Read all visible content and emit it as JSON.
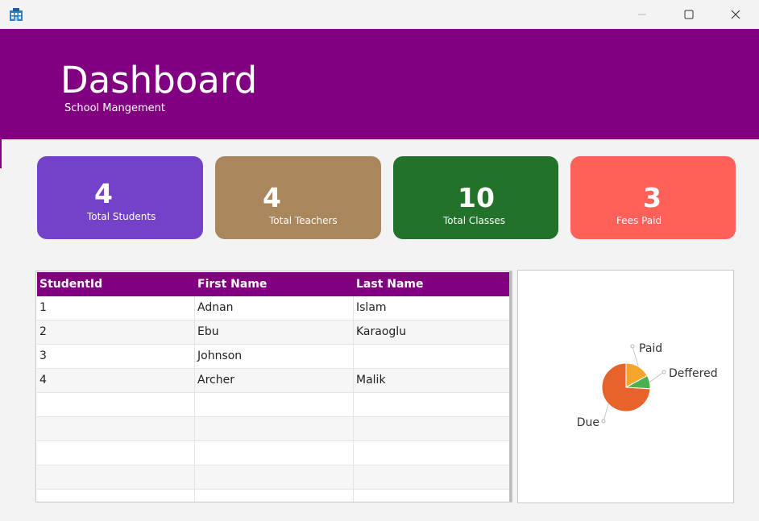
{
  "window": {
    "icon": "school-building-icon",
    "controls": [
      "minimize-icon",
      "maximize-icon",
      "close-icon"
    ]
  },
  "header": {
    "title": "Dashboard",
    "subtitle": "School Mangement",
    "color": "#800080"
  },
  "cards": [
    {
      "value": "4",
      "label": "Total Students",
      "color": "#7442c8"
    },
    {
      "value": "4",
      "label": "Total Teachers",
      "color": "#a9865b"
    },
    {
      "value": "10",
      "label": "Total Classes",
      "color": "#23722a"
    },
    {
      "value": "3",
      "label": "Fees Paid",
      "color": "#ff6058"
    }
  ],
  "table": {
    "columns": [
      "StudentId",
      "First Name",
      "Last Name"
    ],
    "rows": [
      [
        "1",
        "Adnan",
        "Islam"
      ],
      [
        "2",
        "Ebu",
        "Karaoglu"
      ],
      [
        "3",
        "Johnson",
        ""
      ],
      [
        "4",
        "Archer",
        "Malik"
      ],
      [
        "",
        "",
        ""
      ],
      [
        "",
        "",
        ""
      ],
      [
        "",
        "",
        ""
      ],
      [
        "",
        "",
        ""
      ],
      [
        "",
        "",
        ""
      ]
    ],
    "header_color": "#800080"
  },
  "chart_data": {
    "type": "pie",
    "labels": [
      "Paid",
      "Deffered",
      "Due"
    ],
    "values": [
      17,
      9,
      74
    ],
    "colors": [
      "#f4a62a",
      "#4caf50",
      "#e8622c"
    ]
  }
}
